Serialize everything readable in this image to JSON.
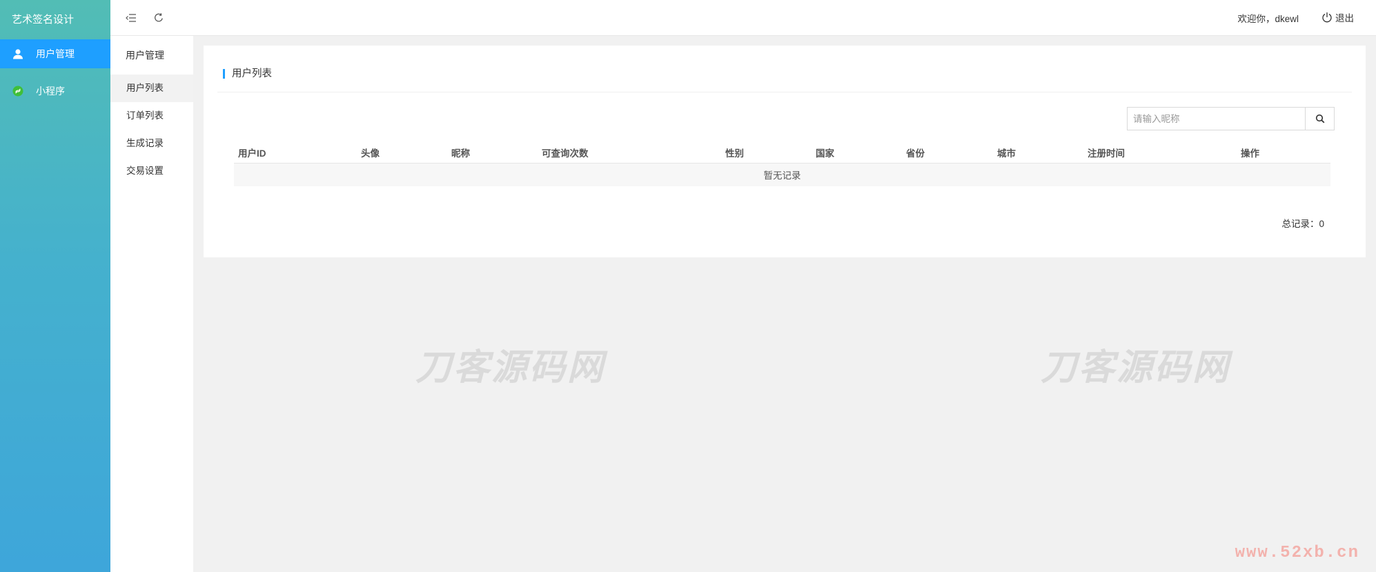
{
  "app": {
    "title": "艺术签名设计"
  },
  "sidebar": {
    "items": [
      {
        "label": "用户管理",
        "icon": "user-icon"
      },
      {
        "label": "小程序",
        "icon": "mini-program-icon"
      }
    ]
  },
  "submenu": {
    "title": "用户管理",
    "items": [
      {
        "label": "用户列表"
      },
      {
        "label": "订单列表"
      },
      {
        "label": "生成记录"
      },
      {
        "label": "交易设置"
      }
    ]
  },
  "topbar": {
    "welcome": "欢迎你，dkewl",
    "logout": "退出"
  },
  "main": {
    "title": "用户列表",
    "search": {
      "placeholder": "请输入昵称",
      "value": ""
    },
    "columns": [
      "用户ID",
      "头像",
      "昵称",
      "可查询次数",
      "性别",
      "国家",
      "省份",
      "城市",
      "注册时间",
      "操作"
    ],
    "empty_text": "暂无记录",
    "total": "总记录：0"
  },
  "watermark": {
    "text": "刀客源码网",
    "url": "www.52xb.cn"
  },
  "colors": {
    "accent": "#1e9fff",
    "sidebar_top": "#52bdb5",
    "sidebar_bottom": "#3ea6da"
  }
}
